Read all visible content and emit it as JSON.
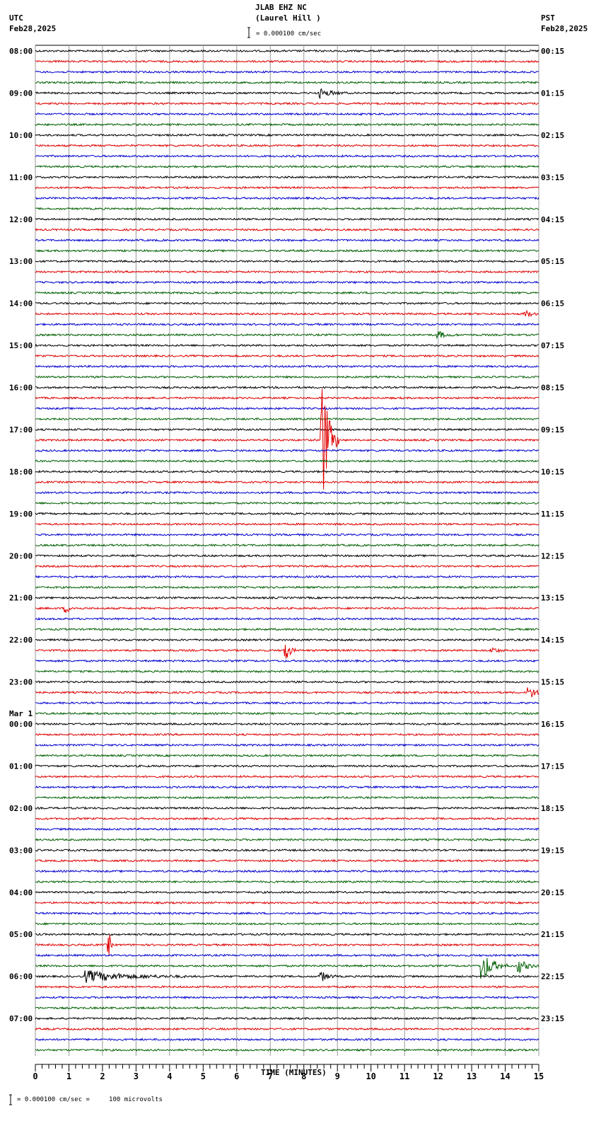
{
  "header": {
    "station": "JLAB EHZ NC",
    "location": "(Laurel Hill )",
    "scale": "= 0.000100 cm/sec",
    "left_tz": "UTC",
    "left_date": "Feb28,2025",
    "right_tz": "PST",
    "right_date": "Feb28,2025"
  },
  "footer": {
    "scale_note": "= 0.000100 cm/sec =     100 microvolts",
    "mark": "x"
  },
  "chart_data": {
    "type": "line",
    "title": "JLAB EHZ NC (Laurel Hill )",
    "xlabel": "TIME (MINUTES)",
    "xlim": [
      0,
      15
    ],
    "x_ticks": [
      "0",
      "1",
      "2",
      "3",
      "4",
      "5",
      "6",
      "7",
      "8",
      "9",
      "10",
      "11",
      "12",
      "13",
      "14",
      "15"
    ],
    "traces_per_hour": 4,
    "trace_colors": [
      "#000000",
      "#e00000",
      "#0000d0",
      "#006000"
    ],
    "left_labels": [
      "08:00",
      "09:00",
      "10:00",
      "11:00",
      "12:00",
      "13:00",
      "14:00",
      "15:00",
      "16:00",
      "17:00",
      "18:00",
      "19:00",
      "20:00",
      "21:00",
      "22:00",
      "23:00",
      "00:00",
      "01:00",
      "02:00",
      "03:00",
      "04:00",
      "05:00",
      "06:00",
      "07:00"
    ],
    "date_change_label": "Mar 1",
    "right_labels": [
      "00:15",
      "01:15",
      "02:15",
      "03:15",
      "04:15",
      "05:15",
      "06:15",
      "07:15",
      "08:15",
      "09:15",
      "10:15",
      "11:15",
      "12:15",
      "13:15",
      "14:15",
      "15:15",
      "16:15",
      "17:15",
      "18:15",
      "19:15",
      "20:15",
      "21:15",
      "22:15",
      "23:15"
    ],
    "events": [
      {
        "trace": 4,
        "minute": 8.5,
        "amplitude": 6,
        "duration": 0.8
      },
      {
        "trace": 27,
        "minute": 12.0,
        "amplitude": 5,
        "duration": 0.6
      },
      {
        "trace": 25,
        "minute": 14.6,
        "amplitude": 5,
        "duration": 0.5
      },
      {
        "trace": 37,
        "minute": 8.55,
        "amplitude": 95,
        "duration": 0.5
      },
      {
        "trace": 53,
        "minute": 0.9,
        "amplitude": 6,
        "duration": 0.4
      },
      {
        "trace": 57,
        "minute": 7.45,
        "amplitude": 18,
        "duration": 0.3
      },
      {
        "trace": 57,
        "minute": 13.6,
        "amplitude": 5,
        "duration": 0.4
      },
      {
        "trace": 61,
        "minute": 14.7,
        "amplitude": 9,
        "duration": 0.6
      },
      {
        "trace": 87,
        "minute": 13.3,
        "amplitude": 22,
        "duration": 0.8
      },
      {
        "trace": 87,
        "minute": 14.4,
        "amplitude": 10,
        "duration": 0.6
      },
      {
        "trace": 85,
        "minute": 2.2,
        "amplitude": 20,
        "duration": 0.1
      },
      {
        "trace": 88,
        "minute": 1.5,
        "amplitude": 8,
        "duration": 3.0
      },
      {
        "trace": 88,
        "minute": 8.5,
        "amplitude": 8,
        "duration": 0.5
      }
    ]
  }
}
